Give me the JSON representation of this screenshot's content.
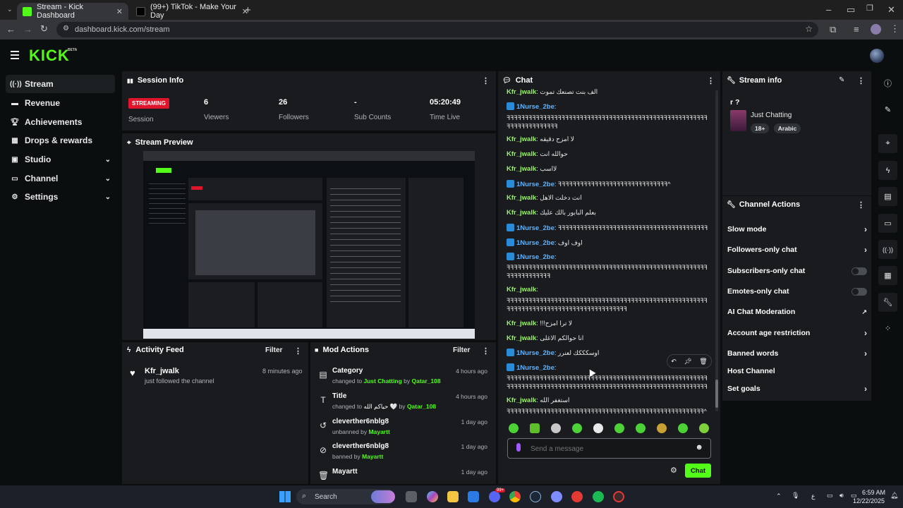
{
  "browser": {
    "tabs": [
      {
        "title": "Stream - Kick Dashboard",
        "active": true
      },
      {
        "title": "(99+) TikTok - Make Your Day",
        "active": false
      }
    ],
    "url": "dashboard.kick.com/stream"
  },
  "brand": {
    "logo": "KICK",
    "beta": "BETA",
    "accent": "#53fc18"
  },
  "sidebar": {
    "items": [
      {
        "label": "Stream",
        "icon": "broadcast-icon"
      },
      {
        "label": "Revenue",
        "icon": "wallet-icon"
      },
      {
        "label": "Achievements",
        "icon": "trophy-icon"
      },
      {
        "label": "Drops & rewards",
        "icon": "gift-icon"
      },
      {
        "label": "Studio",
        "icon": "studio-icon"
      },
      {
        "label": "Channel",
        "icon": "channel-icon"
      },
      {
        "label": "Settings",
        "icon": "gear-icon"
      }
    ]
  },
  "session_info": {
    "title": "Session Info",
    "badge": "STREAMING",
    "session_label": "Session",
    "stats": [
      {
        "value": "6",
        "label": "Viewers"
      },
      {
        "value": "26",
        "label": "Followers"
      },
      {
        "value": "-",
        "label": "Sub Counts"
      },
      {
        "value": "05:20:49",
        "label": "Time Live"
      }
    ]
  },
  "stream_preview": {
    "title": "Stream Preview"
  },
  "activity_feed": {
    "title": "Activity Feed",
    "filter": "Filter",
    "items": [
      {
        "name": "Kfr_jwalk",
        "sub": "just followed the channel",
        "time": "8 minutes ago"
      }
    ]
  },
  "mod_actions": {
    "title": "Mod Actions",
    "filter": "Filter",
    "items": [
      {
        "title": "Category",
        "pre": "changed to",
        "target": "Just Chatting",
        "by": "by",
        "actor": "Qatar_108",
        "time": "4 hours ago"
      },
      {
        "title": "Title",
        "pre": "changed to",
        "target": "حياكم الله 🤍",
        "by": "by",
        "actor": "Qatar_108",
        "time": "4 hours ago"
      },
      {
        "title": "cleverther6nblg8",
        "pre": "unbanned by",
        "target": "",
        "by": "",
        "actor": "Mayartt",
        "time": "1 day ago"
      },
      {
        "title": "cleverther6nblg8",
        "pre": "banned by",
        "target": "",
        "by": "",
        "actor": "Mayartt",
        "time": "1 day ago"
      },
      {
        "title": "Mayartt",
        "pre": "",
        "target": "",
        "by": "",
        "actor": "",
        "time": "1 day ago"
      }
    ]
  },
  "chat": {
    "title": "Chat",
    "messages": [
      {
        "user": "Kfr_jwalk",
        "text": "الف بنت تصنعك تموت",
        "kind": "kfr"
      },
      {
        "user": "1Nurse_2be",
        "text": "",
        "kind": "nurse"
      },
      {
        "user": "",
        "text": "ꟻꟻꟻꟻꟻꟻꟻꟻꟻꟻꟻꟻꟻꟻꟻꟻꟻꟻꟻꟻꟻꟻꟻꟻꟻꟻꟻꟻꟻꟻꟻꟻꟻꟻꟻꟻꟻꟻꟻꟻꟻꟻꟻꟻꟻꟻꟻꟻꟻꟻꟻꟻꟻꟻꟻꟻꟻꟻꟻꟻꟻꟻꟻꟻꟻꟻ",
        "kind": "cont"
      },
      {
        "user": "",
        "text": "ꟻꟻꟻꟻꟻꟻꟻꟻꟻꟻꟻꟻꟻꟻ",
        "kind": "cont"
      },
      {
        "user": "Kfr_jwalk",
        "text": "لا امزح دقيقه",
        "kind": "kfr"
      },
      {
        "user": "Kfr_jwalk",
        "text": "حوالله انت",
        "kind": "kfr"
      },
      {
        "user": "Kfr_jwalk",
        "text": "لااسب",
        "kind": "kfr"
      },
      {
        "user": "1Nurse_2be",
        "text": "ꟻꟻꟻꟻꟻꟻꟻꟻꟻꟻꟻꟻꟻꟻꟻꟻꟻꟻꟻꟻꟻꟻꟻꟻꟻꟻꟻꟻꟻꟻ^",
        "kind": "nurse"
      },
      {
        "user": "Kfr_jwalk",
        "text": "انت دخلت الاهل",
        "kind": "kfr"
      },
      {
        "user": "Kfr_jwalk",
        "text": "بعلم البابور بالك عليك",
        "kind": "kfr"
      },
      {
        "user": "1Nurse_2be",
        "text": "ꟻꟻꟻꟻꟻꟻꟻꟻꟻꟻꟻꟻꟻꟻꟻꟻꟻꟻꟻꟻꟻꟻꟻꟻꟻꟻꟻꟻꟻꟻꟻꟻꟻꟻꟻꟻꟻꟻꟻꟻꟻꟻꟻꟻꟻꟻꟻ^",
        "kind": "nurse"
      },
      {
        "user": "1Nurse_2be",
        "text": "اوف اوف",
        "kind": "nurse"
      },
      {
        "user": "1Nurse_2be",
        "text": "",
        "kind": "nurse"
      },
      {
        "user": "",
        "text": "ꟻꟻꟻꟻꟻꟻꟻꟻꟻꟻꟻꟻꟻꟻꟻꟻꟻꟻꟻꟻꟻꟻꟻꟻꟻꟻꟻꟻꟻꟻꟻꟻꟻꟻꟻꟻꟻꟻꟻꟻꟻꟻꟻꟻꟻꟻꟻꟻꟻꟻꟻꟻꟻꟻꟻꟻꟻꟻꟻꟻꟻꟻꟻꟻꟻꟻꟻ^",
        "kind": "cont"
      },
      {
        "user": "",
        "text": "ꟻꟻꟻꟻꟻꟻꟻꟻꟻꟻꟻꟻ",
        "kind": "cont"
      },
      {
        "user": "Kfr_jwalk",
        "text": "",
        "kind": "kfr"
      },
      {
        "user": "",
        "text": "ꟻꟻꟻꟻꟻꟻꟻꟻꟻꟻꟻꟻꟻꟻꟻꟻꟻꟻꟻꟻꟻꟻꟻꟻꟻꟻꟻꟻꟻꟻꟻꟻꟻꟻꟻꟻꟻꟻꟻꟻꟻꟻꟻꟻꟻꟻꟻꟻꟻꟻꟻꟻꟻꟻꟻꟻꟻꟻꟻꟻꟻꟻꟻꟻꟻꟻꟻꟻꟻꟻꟻꟻ^",
        "kind": "cont"
      },
      {
        "user": "",
        "text": "ꟻꟻꟻꟻꟻꟻꟻꟻꟻꟻꟻꟻꟻꟻꟻꟻꟻꟻꟻꟻꟻꟻꟻꟻꟻꟻꟻꟻꟻꟻꟻꟻꟻ",
        "kind": "cont"
      },
      {
        "user": "Kfr_jwalk",
        "text": "!!!لا ترا امزح",
        "kind": "kfr"
      },
      {
        "user": "Kfr_jwalk",
        "text": "انا حوالكم الاغلى",
        "kind": "kfr"
      },
      {
        "user": "1Nurse_2be",
        "text": "اوسكككك لعنرر",
        "kind": "nurse"
      },
      {
        "user": "1Nurse_2be",
        "text": "",
        "kind": "nurse"
      },
      {
        "user": "",
        "text": "ꟻꟻꟻꟻꟻꟻꟻꟻꟻꟻꟻꟻꟻꟻꟻꟻꟻꟻꟻꟻꟻꟻꟻꟻꟻꟻꟻꟻꟻꟻꟻꟻꟻꟻꟻꟻꟻꟻꟻꟻꟻꟻꟻꟻꟻꟻꟻꟻꟻꟻꟻꟻꟻꟻꟻꟻꟻꟻꟻꟻꟻꟻꟻꟻꟻꟻꟻꟻꟻꟻꟻ^",
        "kind": "cont"
      },
      {
        "user": "",
        "text": "ꟻꟻꟻꟻꟻꟻꟻꟻꟻꟻꟻꟻꟻꟻꟻꟻꟻꟻꟻꟻꟻꟻꟻꟻꟻꟻꟻꟻꟻꟻꟻꟻꟻꟻꟻꟻꟻꟻꟻꟻꟻꟻꟻꟻꟻꟻꟻꟻꟻꟻꟻꟻꟻꟻꟻꟻꟻꟻꟻꟻꟻꟻꟻꟻ",
        "kind": "cont"
      },
      {
        "user": "Kfr_jwalk",
        "text": "استغفر الله",
        "kind": "kfr"
      },
      {
        "user": "",
        "text": "ꟻꟻꟻꟻꟻꟻꟻꟻꟻꟻꟻꟻꟻꟻꟻꟻꟻꟻꟻꟻꟻꟻꟻꟻꟻꟻꟻꟻꟻꟻꟻꟻꟻꟻꟻꟻꟻꟻꟻꟻꟻꟻꟻꟻꟻꟻꟻꟻꟻꟻꟻꟻꟻꟻ^",
        "kind": "cont"
      }
    ],
    "input_placeholder": "Send a message",
    "send_label": "Chat"
  },
  "stream_info": {
    "title": "Stream info",
    "stream_title": "r ?",
    "category": "Just Chatting",
    "tags": [
      "18+",
      "Arabic"
    ]
  },
  "channel_actions": {
    "title": "Channel Actions",
    "items": [
      {
        "label": "Slow mode",
        "control": "arrow"
      },
      {
        "label": "Followers-only chat",
        "control": "arrow"
      },
      {
        "label": "Subscribers-only chat",
        "control": "toggle"
      },
      {
        "label": "Emotes-only chat",
        "control": "toggle"
      },
      {
        "label": "AI Chat Moderation",
        "control": "external"
      },
      {
        "label": "Account age restriction",
        "control": "arrow"
      },
      {
        "label": "Banned words",
        "control": "arrow"
      },
      {
        "label": "Host Channel",
        "control": "none"
      },
      {
        "label": "Set goals",
        "control": "arrow"
      }
    ]
  },
  "taskbar": {
    "search": "Search",
    "time": "6:59 AM",
    "date": "12/22/2025",
    "badge": "99+"
  }
}
